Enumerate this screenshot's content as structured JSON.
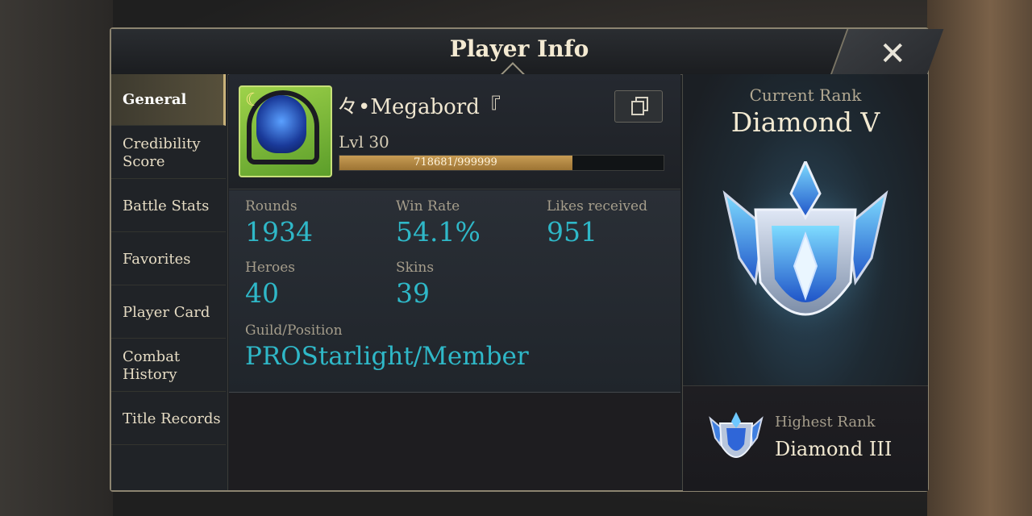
{
  "header": {
    "title": "Player Info"
  },
  "sidebar": {
    "items": [
      {
        "label": "General",
        "active": true
      },
      {
        "label": "Credibility Score",
        "active": false
      },
      {
        "label": "Battle Stats",
        "active": false
      },
      {
        "label": "Favorites",
        "active": false
      },
      {
        "label": "Player Card",
        "active": false
      },
      {
        "label": "Combat History",
        "active": false
      },
      {
        "label": "Title Records",
        "active": false
      }
    ]
  },
  "profile": {
    "name": "々•Megabord『",
    "level": "Lvl 30",
    "xp_text": "718681/999999",
    "xp_current": 718681,
    "xp_max": 999999
  },
  "stats": {
    "rounds_label": "Rounds",
    "rounds": "1934",
    "winrate_label": "Win Rate",
    "winrate": "54.1%",
    "likes_label": "Likes received",
    "likes": "951",
    "heroes_label": "Heroes",
    "heroes": "40",
    "skins_label": "Skins",
    "skins": "39",
    "guild_label": "Guild/Position",
    "guild": "PROStarlight/Member"
  },
  "rank": {
    "current_label": "Current Rank",
    "current": "Diamond V",
    "highest_label": "Highest Rank",
    "highest": "Diamond III"
  },
  "colors": {
    "accent": "#2fb8c8",
    "gold": "#c9b27a"
  },
  "icons": {
    "close": "close-icon",
    "copy": "copy-icon",
    "rank": "diamond-rank-emblem"
  }
}
